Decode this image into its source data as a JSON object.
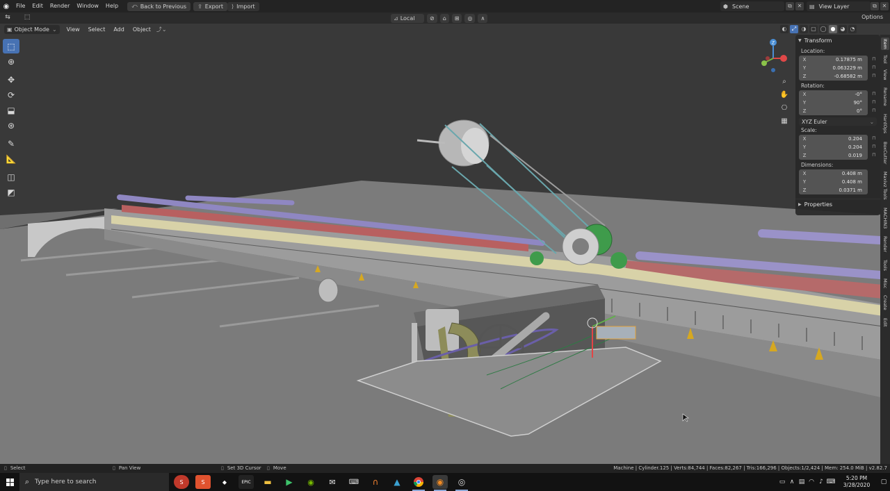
{
  "topbar": {
    "menus": [
      "File",
      "Edit",
      "Render",
      "Window",
      "Help"
    ],
    "buttons": [
      "Back to Previous",
      "Export",
      "Import"
    ],
    "scene": "Scene",
    "view_layer": "View Layer"
  },
  "toolrow": {
    "orientation": "Local",
    "options": "Options"
  },
  "viewport": {
    "mode": "Object Mode",
    "menus": [
      "View",
      "Select",
      "Add",
      "Object"
    ]
  },
  "npanel": {
    "transform_title": "Transform",
    "location_label": "Location:",
    "location": {
      "x": "0.17875 m",
      "y": "0.063229 m",
      "z": "-0.68582 m"
    },
    "rotation_label": "Rotation:",
    "rotation": {
      "x": "-0°",
      "y": "90°",
      "z": "0°"
    },
    "rotation_mode": "XYZ Euler",
    "scale_label": "Scale:",
    "scale": {
      "x": "0.204",
      "y": "0.204",
      "z": "0.019"
    },
    "dimensions_label": "Dimensions:",
    "dimensions": {
      "x": "0.408 m",
      "y": "0.408 m",
      "z": "0.0371 m"
    },
    "properties_title": "Properties",
    "axis": {
      "x": "X",
      "y": "Y",
      "z": "Z"
    }
  },
  "vtabs": [
    "Item",
    "Tool",
    "View",
    "Rename",
    "HardOps",
    "BoxCutter",
    "Maxivz Tools",
    "MACHIN3",
    "Render",
    "Tools",
    "Misc",
    "Create",
    "Edit"
  ],
  "statusbar": {
    "select": "Select",
    "pan": "Pan View",
    "cursor": "Set 3D Cursor",
    "move": "Move",
    "stats": "Machine | Cylinder.125 | Verts:84,744 | Faces:82,267 | Tris:166,296 | Objects:1/2,424 | Mem: 254.0 MiB | v2.82.7"
  },
  "taskbar": {
    "search_placeholder": "Type here to search",
    "time": "5:20 PM",
    "date": "3/28/2020",
    "epic_label": "EPIC"
  },
  "gizmo": {
    "x": "X",
    "y": "Y",
    "z": "Z"
  },
  "colors": {
    "accent": "#4772b3",
    "viewport": "#393939",
    "panel": "#282828"
  }
}
